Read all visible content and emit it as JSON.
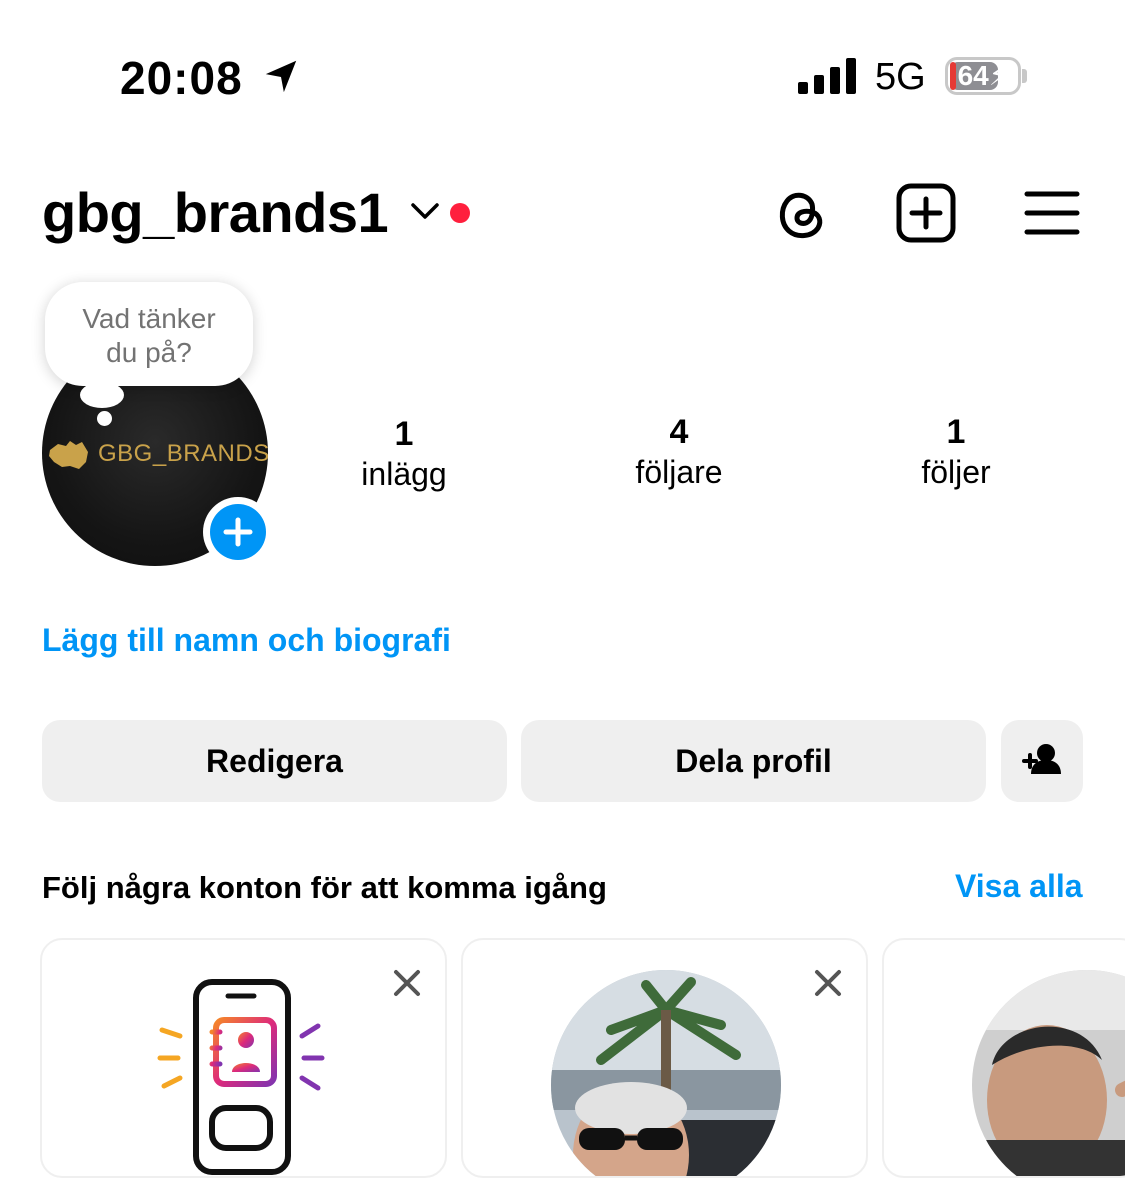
{
  "status_bar": {
    "time": "20:08",
    "network": "5G",
    "battery": "64",
    "battery_level_percent": 64
  },
  "header": {
    "username": "gbg_brands1",
    "accent_red": "#ff1f3d"
  },
  "profile": {
    "note_bubble_line1": "Vad tänker",
    "note_bubble_line2": "du på?",
    "avatar_text": "GBG_BRANDS",
    "stats": [
      {
        "value": "1",
        "label": "inlägg"
      },
      {
        "value": "4",
        "label": "följare"
      },
      {
        "value": "1",
        "label": "följer"
      }
    ],
    "bio_link": "Lägg till namn och biografi"
  },
  "actions": {
    "edit_label": "Redigera",
    "share_label": "Dela profil",
    "add_user_icon": "person-add-icon"
  },
  "suggestions": {
    "title": "Följ några konton för att komma igång",
    "see_all": "Visa alla",
    "cards": [
      {
        "type": "contacts",
        "icon": "phone-contacts-icon"
      },
      {
        "type": "account",
        "icon": "profile-photo"
      },
      {
        "type": "account",
        "icon": "profile-photo"
      }
    ]
  },
  "colors": {
    "link_blue": "#0095f6",
    "button_bg": "#efefef",
    "text": "#000000",
    "secondary_text": "#737373"
  }
}
